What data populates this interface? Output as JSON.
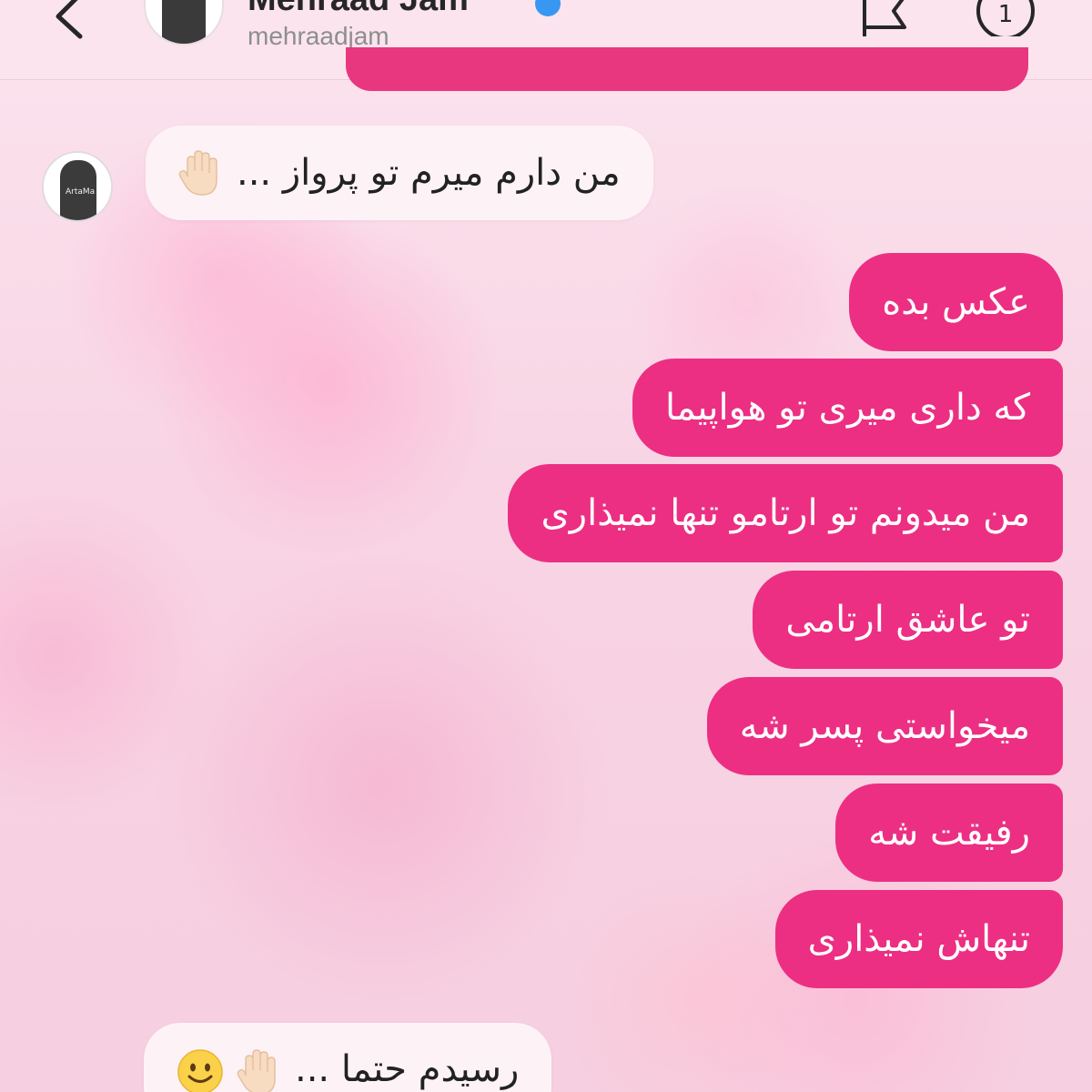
{
  "header": {
    "name": "Mehraad Jam",
    "username": "mehraadjam",
    "back_icon": "chevron-left-icon",
    "flag_icon": "flag-icon",
    "info_icon": "info-icon"
  },
  "messages": {
    "incoming_1": "من دارم میرم تو پرواز ...",
    "outgoing": [
      "عکس بده",
      "که داری میری تو هواپیما",
      "من میدونم تو ارتامو تنها نمیذاری",
      "تو عاشق ارتامی",
      "میخواستی پسر شه",
      "رفیقت شه",
      "تنهاش نمیذاری"
    ],
    "incoming_2": "رسیدم حتما ..."
  },
  "avatar_text": "ArtaMa",
  "colors": {
    "outgoing_bubble": "#ec2f82",
    "incoming_bubble": "#fdf3f6",
    "background": "#f8d9e6",
    "verified": "#3897f0"
  }
}
